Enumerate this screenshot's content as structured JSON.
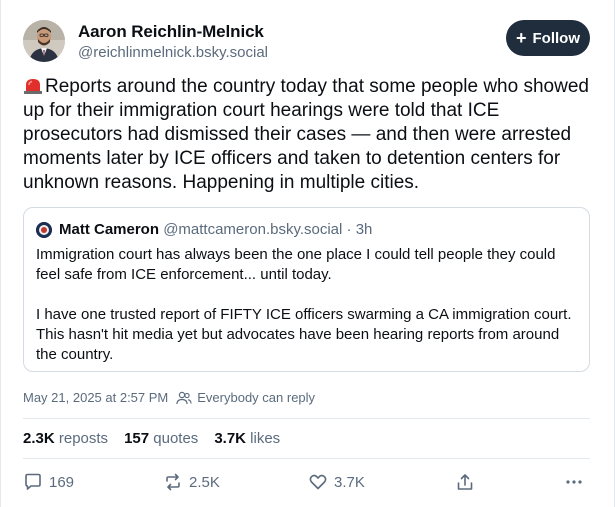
{
  "author": {
    "name": "Aaron Reichlin-Melnick",
    "handle": "@reichlinmelnick.bsky.social",
    "avatar_icon": "person-avatar-icon"
  },
  "follow_button": {
    "icon": "plus-icon",
    "label": "Follow"
  },
  "post": {
    "emoji": "siren-emoji",
    "text": "Reports around the country today that some people who showed up for their immigration court hearings were told that ICE prosecutors had dismissed their cases — and then were arrested moments later by ICE officers and taken to detention centers for unknown reasons. Happening in multiple cities."
  },
  "quote": {
    "author_name": "Matt Cameron",
    "author_handle": "@mattcameron.bsky.social · 3h",
    "paragraphs": [
      "Immigration court has always been the one place I could tell people they could feel safe from ICE enforcement... until today.",
      "I have one trusted report of FIFTY ICE officers swarming a CA immigration court. This hasn't hit media yet but advocates have been hearing reports from around the country."
    ]
  },
  "meta": {
    "timestamp": "May 21, 2025 at 2:57 PM",
    "reply_setting": "Everybody can reply"
  },
  "stats": {
    "reposts_count": "2.3K",
    "reposts_label": "reposts",
    "quotes_count": "157",
    "quotes_label": "quotes",
    "likes_count": "3.7K",
    "likes_label": "likes"
  },
  "actions": {
    "reply_count": "169",
    "repost_count": "2.5K",
    "like_count": "3.7K"
  },
  "colors": {
    "follow_bg": "#1f2d3d",
    "muted_text": "#5b6b7d",
    "border": "#d4dbe2"
  }
}
